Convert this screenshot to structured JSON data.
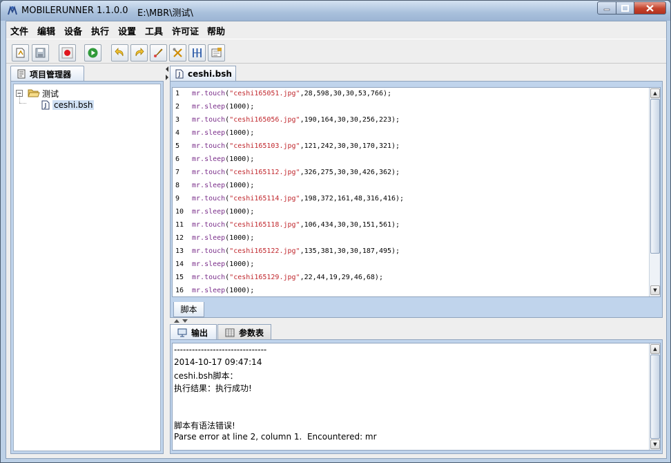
{
  "window": {
    "title": "MOBILERUNNER 1.1.0.0",
    "path": "E:\\MBR\\测试\\"
  },
  "menu": [
    "文件",
    "编辑",
    "设备",
    "执行",
    "设置",
    "工具",
    "许可证",
    "帮助"
  ],
  "toolbar_icons": [
    "new-file-icon",
    "save-icon",
    "record-icon",
    "run-icon",
    "undo-icon",
    "redo-icon",
    "rocket-icon",
    "tools-icon",
    "columns-icon",
    "settings-icon"
  ],
  "project_panel": {
    "tab_label": "项目管理器",
    "tree": {
      "folder": "测试",
      "file": "ceshi.bsh"
    }
  },
  "editor": {
    "tab_label": "ceshi.bsh",
    "bottom_tab": "脚本",
    "lines": [
      {
        "n": "1",
        "obj": "mr",
        "fn": "touch",
        "str": "\"ceshi165051.jpg\"",
        "args": ",28,598,30,30,53,766);"
      },
      {
        "n": "2",
        "obj": "mr",
        "fn": "sleep",
        "str": "",
        "args": "(1000);"
      },
      {
        "n": "3",
        "obj": "mr",
        "fn": "touch",
        "str": "\"ceshi165056.jpg\"",
        "args": ",190,164,30,30,256,223);"
      },
      {
        "n": "4",
        "obj": "mr",
        "fn": "sleep",
        "str": "",
        "args": "(1000);"
      },
      {
        "n": "5",
        "obj": "mr",
        "fn": "touch",
        "str": "\"ceshi165103.jpg\"",
        "args": ",121,242,30,30,170,321);"
      },
      {
        "n": "6",
        "obj": "mr",
        "fn": "sleep",
        "str": "",
        "args": "(1000);"
      },
      {
        "n": "7",
        "obj": "mr",
        "fn": "touch",
        "str": "\"ceshi165112.jpg\"",
        "args": ",326,275,30,30,426,362);"
      },
      {
        "n": "8",
        "obj": "mr",
        "fn": "sleep",
        "str": "",
        "args": "(1000);"
      },
      {
        "n": "9",
        "obj": "mr",
        "fn": "touch",
        "str": "\"ceshi165114.jpg\"",
        "args": ",198,372,161,48,316,416);"
      },
      {
        "n": "10",
        "obj": "mr",
        "fn": "sleep",
        "str": "",
        "args": "(1000);"
      },
      {
        "n": "11",
        "obj": "mr",
        "fn": "touch",
        "str": "\"ceshi165118.jpg\"",
        "args": ",106,434,30,30,151,561);"
      },
      {
        "n": "12",
        "obj": "mr",
        "fn": "sleep",
        "str": "",
        "args": "(1000);"
      },
      {
        "n": "13",
        "obj": "mr",
        "fn": "touch",
        "str": "\"ceshi165122.jpg\"",
        "args": ",135,381,30,30,187,495);"
      },
      {
        "n": "14",
        "obj": "mr",
        "fn": "sleep",
        "str": "",
        "args": "(1000);"
      },
      {
        "n": "15",
        "obj": "mr",
        "fn": "touch",
        "str": "\"ceshi165129.jpg\"",
        "args": ",22,44,19,29,46,68);"
      },
      {
        "n": "16",
        "obj": "mr",
        "fn": "sleep",
        "str": "",
        "args": "(1000);"
      }
    ]
  },
  "output_panel": {
    "tabs": [
      "输出",
      "参数表"
    ],
    "lines": [
      "-------------------------------",
      "2014-10-17 09:47:14",
      "ceshi.bsh脚本：",
      "执行结果：执行成功!",
      "",
      "",
      "脚本有语法错误!",
      "Parse error at line 2, column 1.  Encountered: mr"
    ]
  },
  "colors": {
    "keyword": "#7a2e8a",
    "string": "#c0272d",
    "panel_border": "#8fa3bd",
    "titlebar": "#a9c0dc"
  }
}
